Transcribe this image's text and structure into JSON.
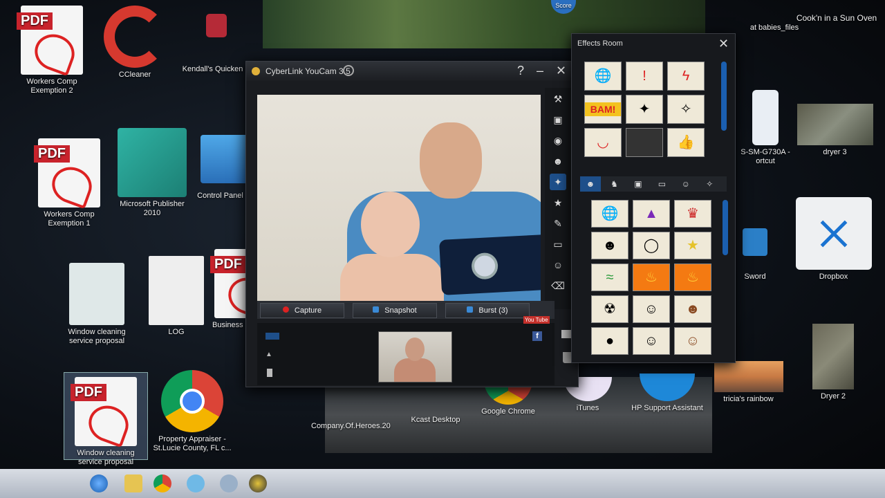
{
  "desktop": {
    "icons": [
      {
        "id": "workers-comp-2",
        "label": "Workers Comp Exemption 2",
        "badge": "PDF"
      },
      {
        "id": "ccleaner",
        "label": "CCleaner"
      },
      {
        "id": "quicken",
        "label": "Kendall's Quicken D"
      },
      {
        "id": "workers-comp-1",
        "label": "Workers Comp Exemption 1",
        "badge": "PDF"
      },
      {
        "id": "publisher",
        "label": "Microsoft Publisher 2010"
      },
      {
        "id": "control-panel",
        "label": "Control Panel - Shor"
      },
      {
        "id": "window-cleaning-pub",
        "label": "Window cleaning service proposal"
      },
      {
        "id": "log",
        "label": "LOG"
      },
      {
        "id": "business-insurance",
        "label": "Business Insurance",
        "badge": "PDF"
      },
      {
        "id": "window-cleaning-pdf",
        "label": "Window cleaning service proposal",
        "badge": "PDF"
      },
      {
        "id": "property-appraiser",
        "label": "Property Appraiser - St.Lucie County, FL c..."
      },
      {
        "id": "company-heroes",
        "label": "Company.Of.Heroes.20"
      },
      {
        "id": "kcast",
        "label": "Kcast Desktop"
      },
      {
        "id": "chrome",
        "label": "Google Chrome"
      },
      {
        "id": "itunes",
        "label": "iTunes"
      },
      {
        "id": "hp-support",
        "label": "HP Support Assistant"
      },
      {
        "id": "babies-files",
        "label": "at babies_files"
      },
      {
        "id": "cookn",
        "label": "Cook'n in a Sun Oven"
      },
      {
        "id": "sm-g730a",
        "label": "S-SM-G730A - ortcut"
      },
      {
        "id": "dryer3",
        "label": "dryer 3"
      },
      {
        "id": "sword",
        "label": "Sword"
      },
      {
        "id": "dropbox",
        "label": "Dropbox"
      },
      {
        "id": "tricias-rainbow",
        "label": "tricia's rainbow"
      },
      {
        "id": "dryer2",
        "label": "Dryer 2"
      },
      {
        "id": "score",
        "label": "Score"
      }
    ]
  },
  "youcam": {
    "title": "CyberLink YouCam 3.5",
    "help": "?",
    "minimize": "–",
    "close": "✕",
    "capture_label": "Capture",
    "snapshot_label": "Snapshot",
    "burst_label": "Burst (3)",
    "youtube_label": "You Tube",
    "facebook_label": "f"
  },
  "effects": {
    "title": "Effects Room",
    "close": "✕",
    "bam_label": "BAM!"
  },
  "colors": {
    "accent": "#1e4f8a",
    "pdf_red": "#c8232c",
    "panel": "#17191d"
  }
}
